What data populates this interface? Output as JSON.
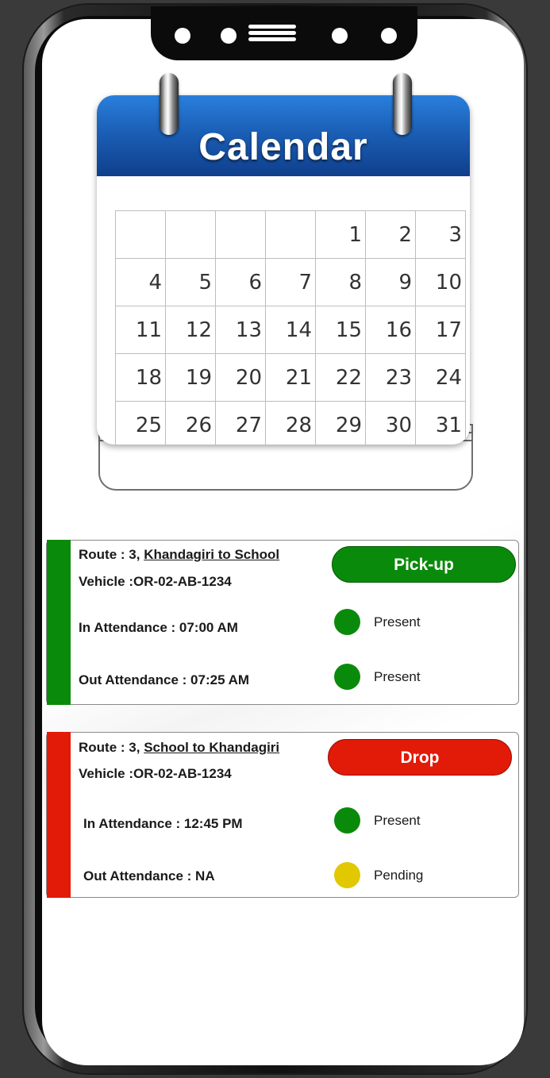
{
  "calendar": {
    "title": "Calendar",
    "rows": [
      [
        "",
        "",
        "",
        "",
        "1",
        "2",
        "3"
      ],
      [
        "4",
        "5",
        "6",
        "7",
        "8",
        "9",
        "10"
      ],
      [
        "11",
        "12",
        "13",
        "14",
        "15",
        "16",
        "17"
      ],
      [
        "18",
        "19",
        "20",
        "21",
        "22",
        "23",
        "24"
      ],
      [
        "25",
        "26",
        "27",
        "28",
        "29",
        "30",
        "31"
      ]
    ]
  },
  "colors": {
    "pickup": "#0a8a0a",
    "drop": "#e21a08",
    "present": "#0a8a0a",
    "pending": "#e2c800",
    "calendar_header": "#1b5fb6"
  },
  "pickup_card": {
    "route_prefix": "Route : 3,",
    "route_link": "Khandagiri to School",
    "vehicle": "Vehicle :OR-02-AB-1234",
    "type_label": "Pick-up",
    "in_attendance": "In Attendance  :  07:00 AM",
    "in_status": "Present",
    "out_attendance": "Out Attendance  : 07:25 AM",
    "out_status": "Present"
  },
  "drop_card": {
    "route_prefix": "Route : 3,",
    "route_link": "School to Khandagiri",
    "vehicle": "Vehicle :OR-02-AB-1234",
    "type_label": "Drop",
    "in_attendance": "In Attendance  :  12:45 PM",
    "in_status": "Present",
    "out_attendance": "Out Attendance  : NA",
    "out_status": "Pending"
  }
}
